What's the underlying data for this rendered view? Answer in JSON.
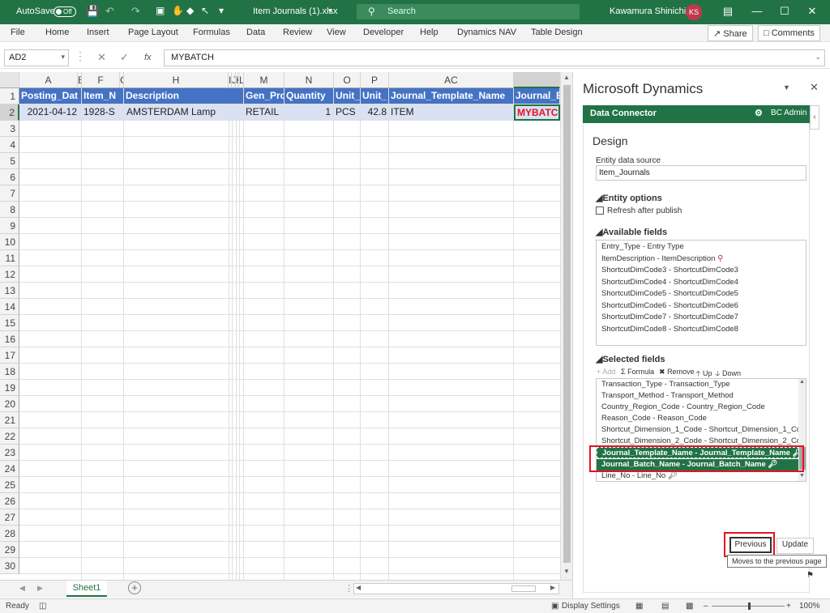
{
  "titlebar": {
    "autosave_label": "AutoSave",
    "autosave_state": "Off",
    "filename": "Item Journals (1).xlsx",
    "search_placeholder": "Search",
    "user_name": "Kawamura Shinichi",
    "user_initials": "KS"
  },
  "menu": {
    "items": [
      "File",
      "Home",
      "Insert",
      "Page Layout",
      "Formulas",
      "Data",
      "Review",
      "View",
      "Developer",
      "Help",
      "Dynamics NAV",
      "Table Design"
    ],
    "share": "Share",
    "comments": "Comments"
  },
  "formula": {
    "name_box": "AD2",
    "fx": "fx",
    "value": "MYBATCH"
  },
  "grid": {
    "columns": [
      "A",
      "E",
      "F",
      "G",
      "H",
      "I",
      "J",
      "K",
      "L",
      "M",
      "N",
      "O",
      "P",
      "AC",
      ""
    ],
    "header_row": [
      "Posting_Dat",
      "Item_N",
      "Description",
      "Gen_Prc",
      "Quantity",
      "Unit_",
      "Unit_",
      "Journal_Template_Name",
      "Journal_B"
    ],
    "data_row": [
      "2021-04-12",
      "1928-S",
      "AMSTERDAM Lamp",
      "RETAIL",
      "1",
      "PCS",
      "42.8",
      "ITEM",
      "MYBATC"
    ],
    "row_numbers": [
      "1",
      "2",
      "3",
      "4",
      "5",
      "6",
      "7",
      "8",
      "9",
      "10",
      "11",
      "12",
      "13",
      "14",
      "15",
      "16",
      "17",
      "18",
      "19",
      "20",
      "21",
      "22",
      "23",
      "24",
      "25",
      "26",
      "27",
      "28",
      "29",
      "30"
    ]
  },
  "sheet": {
    "tab": "Sheet1"
  },
  "status": {
    "ready": "Ready",
    "display_settings": "Display Settings",
    "zoom": "100%"
  },
  "pane": {
    "title": "Microsoft Dynamics",
    "connector": "Data Connector",
    "admin": "BC Admin",
    "design": "Design",
    "entity_label": "Entity data source",
    "entity_value": "Item_Journals",
    "entity_options": "Entity options",
    "refresh": "Refresh after publish",
    "available_fields": "Available fields",
    "available": [
      "Entry_Type - Entry Type",
      "ItemDescription - ItemDescription",
      "ShortcutDimCode3 - ShortcutDimCode3",
      "ShortcutDimCode4 - ShortcutDimCode4",
      "ShortcutDimCode5 - ShortcutDimCode5",
      "ShortcutDimCode6 - ShortcutDimCode6",
      "ShortcutDimCode7 - ShortcutDimCode7",
      "ShortcutDimCode8 - ShortcutDimCode8"
    ],
    "selected_fields": "Selected fields",
    "toolbar": {
      "add": "Add",
      "formula": "Formula",
      "remove": "Remove",
      "up": "Up",
      "down": "Down"
    },
    "selected": [
      "Transaction_Type - Transaction_Type",
      "Transport_Method - Transport_Method",
      "Country_Region_Code - Country_Region_Code",
      "Reason_Code - Reason_Code",
      "Shortcut_Dimension_1_Code - Shortcut_Dimension_1_Coc",
      "Shortcut_Dimension_2_Code - Shortcut_Dimension_2_Coc",
      "Journal_Template_Name - Journal_Template_Name",
      "Journal_Batch_Name - Journal_Batch_Name",
      "Line_No - Line_No"
    ],
    "previous": "Previous",
    "update": "Update",
    "tooltip": "Moves to the previous page"
  },
  "colors": {
    "excel_green": "#217346",
    "table_header": "#4472c4",
    "table_band": "#d9e1f2",
    "highlight_red": "#e81123"
  }
}
